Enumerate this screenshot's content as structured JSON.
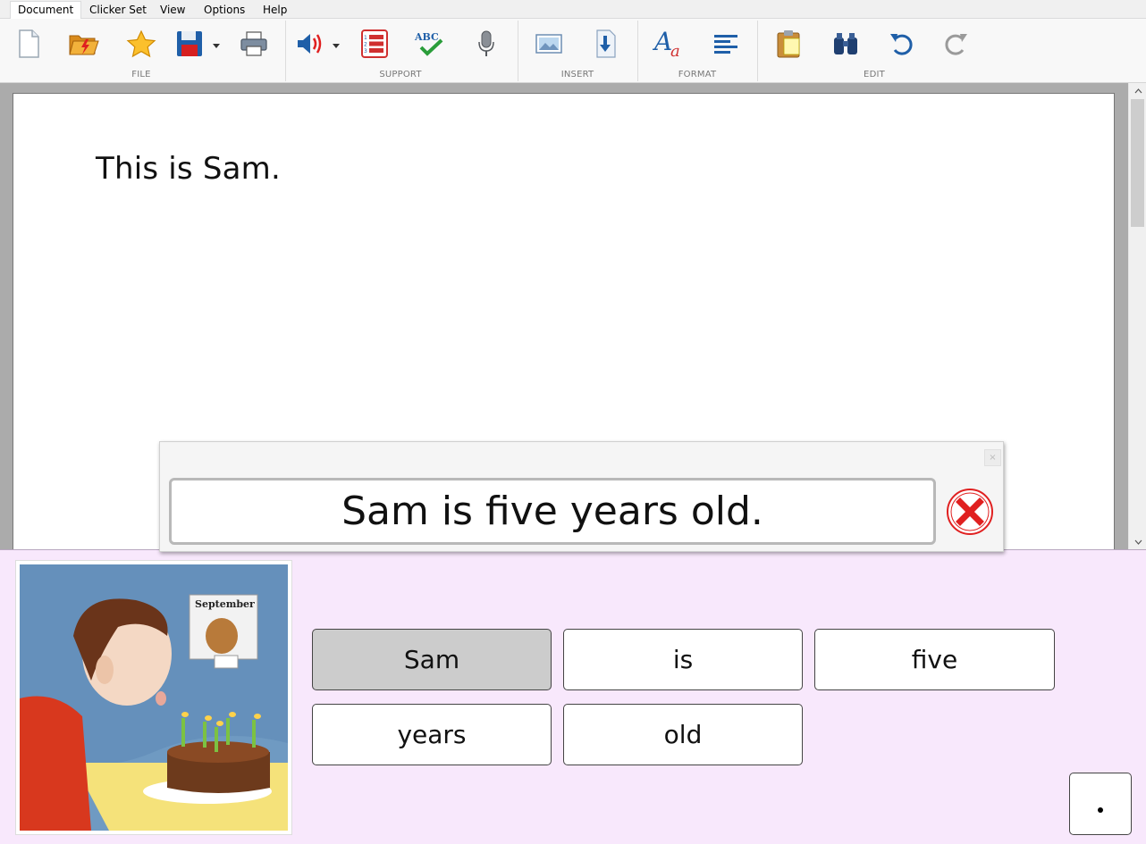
{
  "menu": {
    "tabs": [
      {
        "label": "Document"
      },
      {
        "label": "Clicker Set"
      },
      {
        "label": "View"
      },
      {
        "label": "Options"
      },
      {
        "label": "Help"
      }
    ]
  },
  "ribbon": {
    "groups": {
      "file": "FILE",
      "support": "SUPPORT",
      "insert": "INSERT",
      "format": "FORMAT",
      "edit": "EDIT"
    },
    "spellcheck_glyph": "ABC"
  },
  "document": {
    "text": "This is Sam."
  },
  "popup": {
    "sentence": "Sam is five years old.",
    "mini_close": "×"
  },
  "picture": {
    "calendar_label": "September"
  },
  "grid": {
    "cells": [
      {
        "label": "Sam",
        "selected": true
      },
      {
        "label": "is"
      },
      {
        "label": "five"
      },
      {
        "label": "years"
      },
      {
        "label": "old"
      }
    ]
  },
  "colors": {
    "grid_background": "#f8e8fc",
    "selected_cell": "#cccccc",
    "clear_button": "#e02020"
  }
}
